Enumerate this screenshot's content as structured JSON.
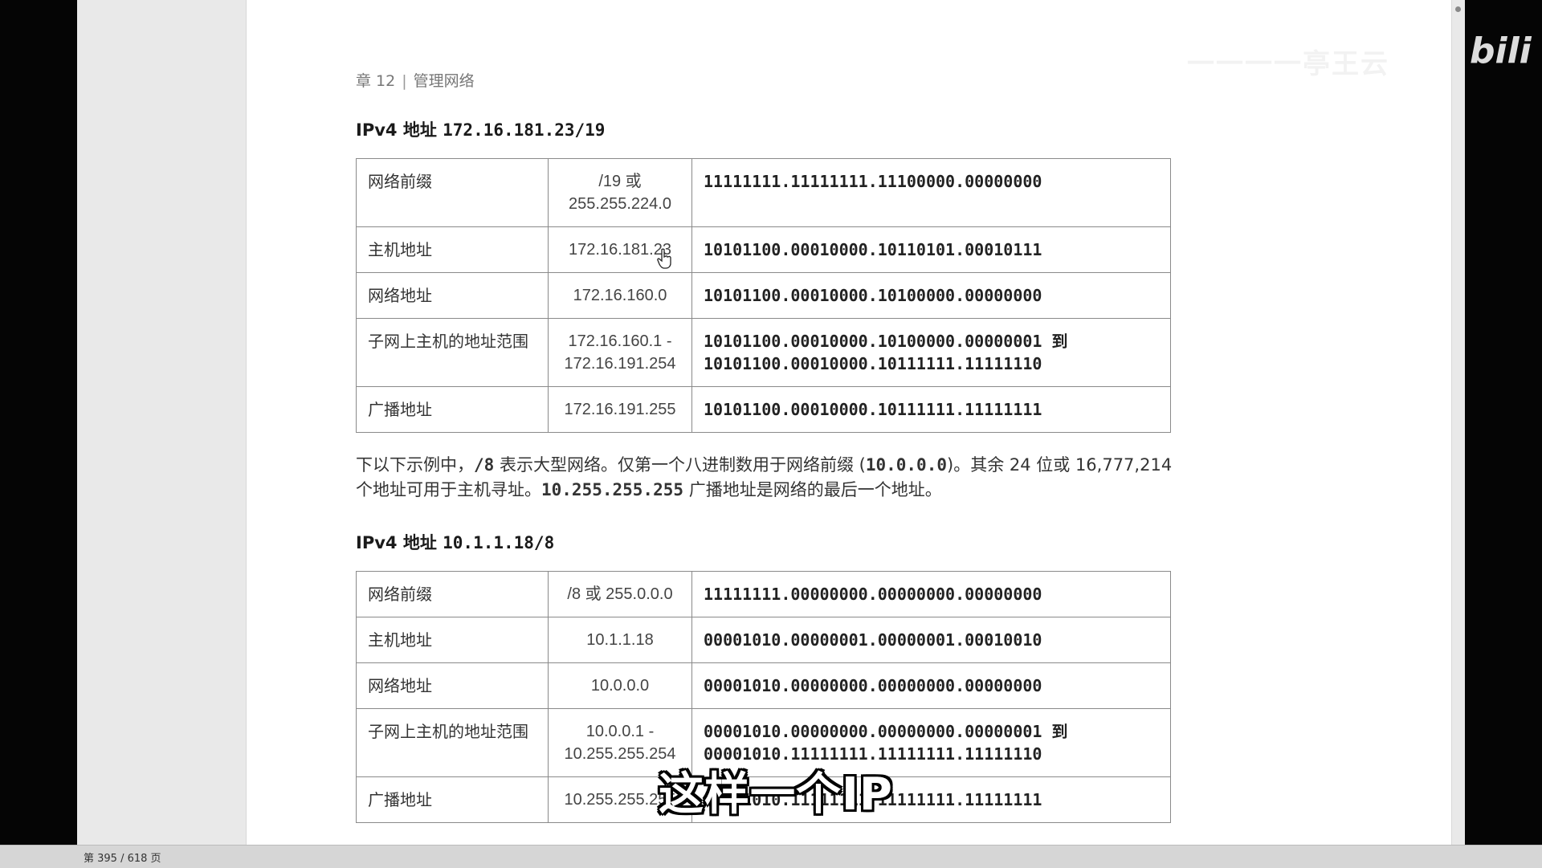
{
  "watermark": {
    "brand_cn": "一一一一亭王云",
    "logo": "bili"
  },
  "header": {
    "chapter": "章 12",
    "section": "管理网络"
  },
  "table1": {
    "caption_prefix": "IPv4 地址",
    "caption_addr": "172.16.181.23/19",
    "rows": [
      {
        "label": "网络前缀",
        "decimal": "/19 或 255.255.224.0",
        "binary": "11111111.11111111.11100000.00000000"
      },
      {
        "label": "主机地址",
        "decimal": "172.16.181.23",
        "binary": "10101100.00010000.10110101.00010111"
      },
      {
        "label": "网络地址",
        "decimal": "172.16.160.0",
        "binary": "10101100.00010000.10100000.00000000"
      },
      {
        "label": "子网上主机的地址范围",
        "decimal": "172.16.160.1 - 172.16.191.254",
        "binary": "10101100.00010000.10100000.00000001 到 10101100.00010000.10111111.11111110"
      },
      {
        "label": "广播地址",
        "decimal": "172.16.191.255",
        "binary": "10101100.00010000.10111111.11111111"
      }
    ]
  },
  "paragraph": {
    "t1": "下以下示例中，",
    "m1": "/8",
    "t2": " 表示大型网络。仅第一个八进制数用于网络前缀 (",
    "m2": "10.0.0.0",
    "t3": ")。其余 24 位或 16,777,214 个地址可用于主机寻址。",
    "m3": "10.255.255.255",
    "t4": " 广播地址是网络的最后一个地址。"
  },
  "table2": {
    "caption_prefix": "IPv4 地址",
    "caption_addr": "10.1.1.18/8",
    "rows": [
      {
        "label": "网络前缀",
        "decimal": "/8 或 255.0.0.0",
        "binary": "11111111.00000000.00000000.00000000"
      },
      {
        "label": "主机地址",
        "decimal": "10.1.1.18",
        "binary": "00001010.00000001.00000001.00010010"
      },
      {
        "label": "网络地址",
        "decimal": "10.0.0.0",
        "binary": "00001010.00000000.00000000.00000000"
      },
      {
        "label": "子网上主机的地址范围",
        "decimal": "10.0.0.1 - 10.255.255.254",
        "binary": "00001010.00000000.00000000.00000001 到 00001010.11111111.11111111.11111110"
      },
      {
        "label": "广播地址",
        "decimal": "10.255.255.255",
        "binary": "00001010.11111111.11111111.11111111"
      }
    ]
  },
  "subtitle": "这样一个IP",
  "status": {
    "page_indicator": "第 395 / 618 页"
  }
}
